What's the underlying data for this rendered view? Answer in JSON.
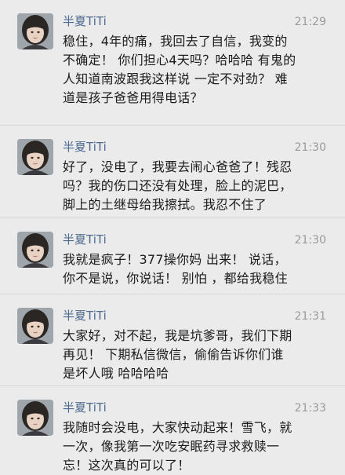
{
  "posts": [
    {
      "author": "半夏TiTi",
      "time": "21:29",
      "avatar_icon": "user-avatar-icon",
      "lines": [
        "稳住，4年的痛，我回去了自信，我变的",
        "不确定！ 你们担心4天吗？哈哈哈 有鬼的",
        "人知道南波跟我这样说 一定不对劲？ 难",
        "道是孩子爸爸用得电话？"
      ]
    },
    {
      "author": "半夏TiTi",
      "time": "21:30",
      "avatar_icon": "user-avatar-icon",
      "lines": [
        "好了，没电了，我要去闹心爸爸了！残忍",
        "吗？我的伤口还没有处理，脸上的泥巴，",
        "脚上的土继母给我擦拭。我忍不住了"
      ]
    },
    {
      "author": "半夏TiTi",
      "time": "21:30",
      "avatar_icon": "user-avatar-icon",
      "lines": [
        "我就是疯子！377操你妈 出来！ 说话，",
        "你不是说，你说话！ 别怕 ，都给我稳住"
      ]
    },
    {
      "author": "半夏TiTi",
      "time": "21:31",
      "avatar_icon": "user-avatar-icon",
      "lines": [
        "大家好，对不起，我是坑爹哥，我们下期",
        "再见！ 下期私信微信，偷偷告诉你们谁",
        "是坏人哦 哈哈哈哈"
      ]
    },
    {
      "author": "半夏TiTi",
      "time": "21:33",
      "avatar_icon": "user-avatar-icon",
      "lines": [
        "我随时会没电，大家快动起来！雪飞，就",
        "一次，像我第一次吃安眠药寻求救赎一",
        "忘！这次真的可以了！"
      ]
    }
  ]
}
